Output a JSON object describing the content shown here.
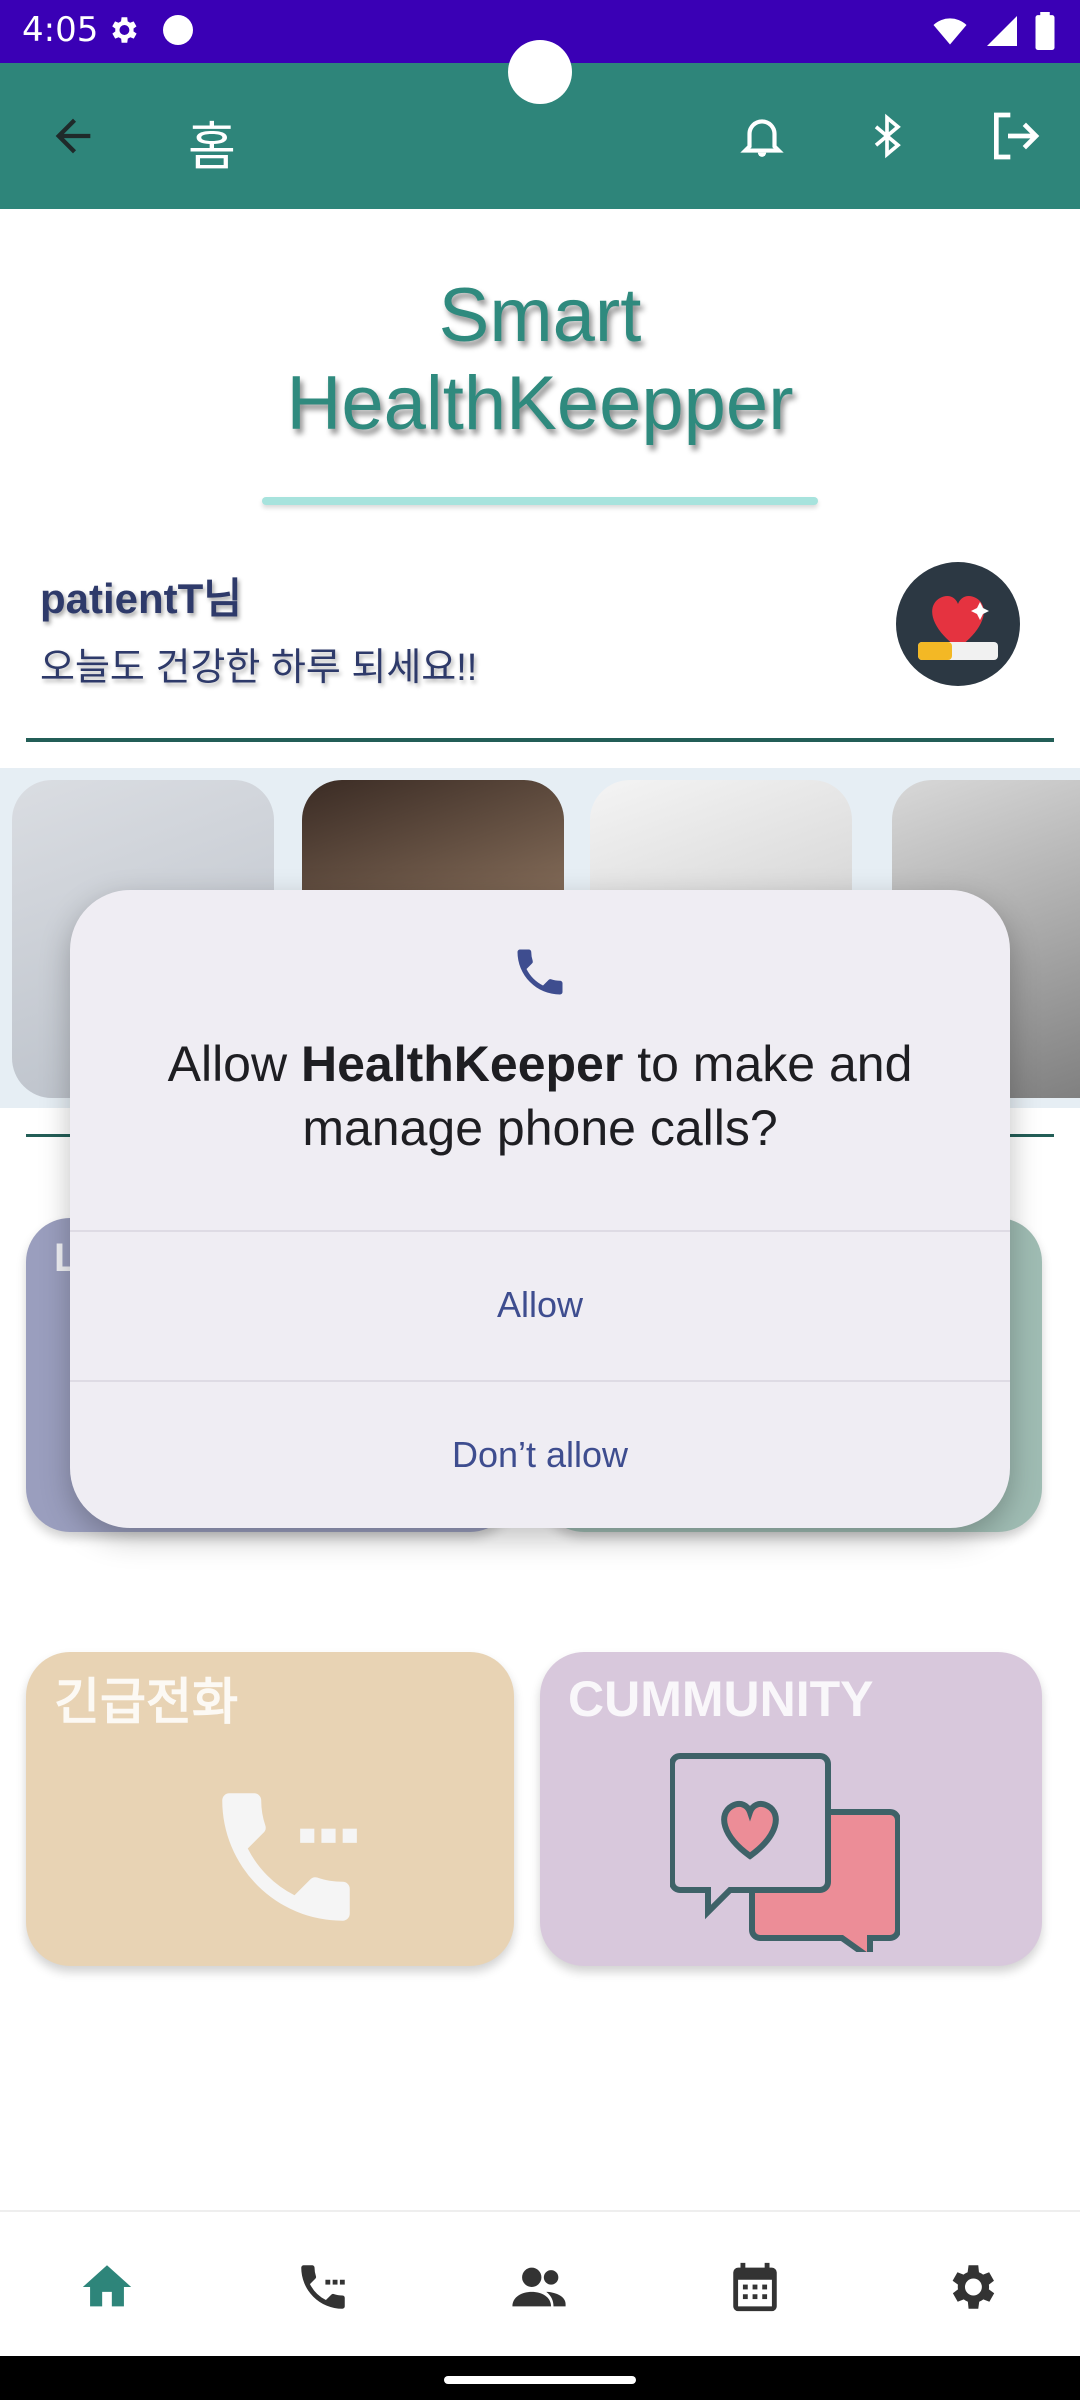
{
  "status_bar": {
    "time": "4:05",
    "icons": [
      "settings-icon",
      "circle-icon",
      "wifi-icon",
      "signal-icon",
      "battery-icon"
    ]
  },
  "app_bar": {
    "title": "홈",
    "icons": [
      "back-arrow-icon",
      "bell-icon",
      "bluetooth-icon",
      "logout-icon"
    ]
  },
  "header": {
    "title_line1": "Smart",
    "title_line2": "HealthKeepper"
  },
  "greeting": {
    "name": "patientT님",
    "message": "오늘도 건강한 하루 되세요!!"
  },
  "cards": {
    "top_left_partial": "L",
    "emergency": "긴급전화",
    "community": "CUMMUNITY"
  },
  "dialog": {
    "title_prefix": "Allow ",
    "app_name": "HealthKeeper",
    "title_suffix": " to make and manage phone calls?",
    "allow": "Allow",
    "deny": "Don’t allow",
    "icon": "phone-icon"
  },
  "bottom_nav": {
    "items": [
      "home-icon",
      "phone-call-icon",
      "people-icon",
      "calendar-icon",
      "settings-icon"
    ],
    "active": "home-icon",
    "active_color": "#2e857a"
  },
  "colors": {
    "status_bar": "#3a00b5",
    "app_bar": "#2e857a",
    "dialog_bg": "#efedf3",
    "dialog_button": "#3e4d8f"
  }
}
